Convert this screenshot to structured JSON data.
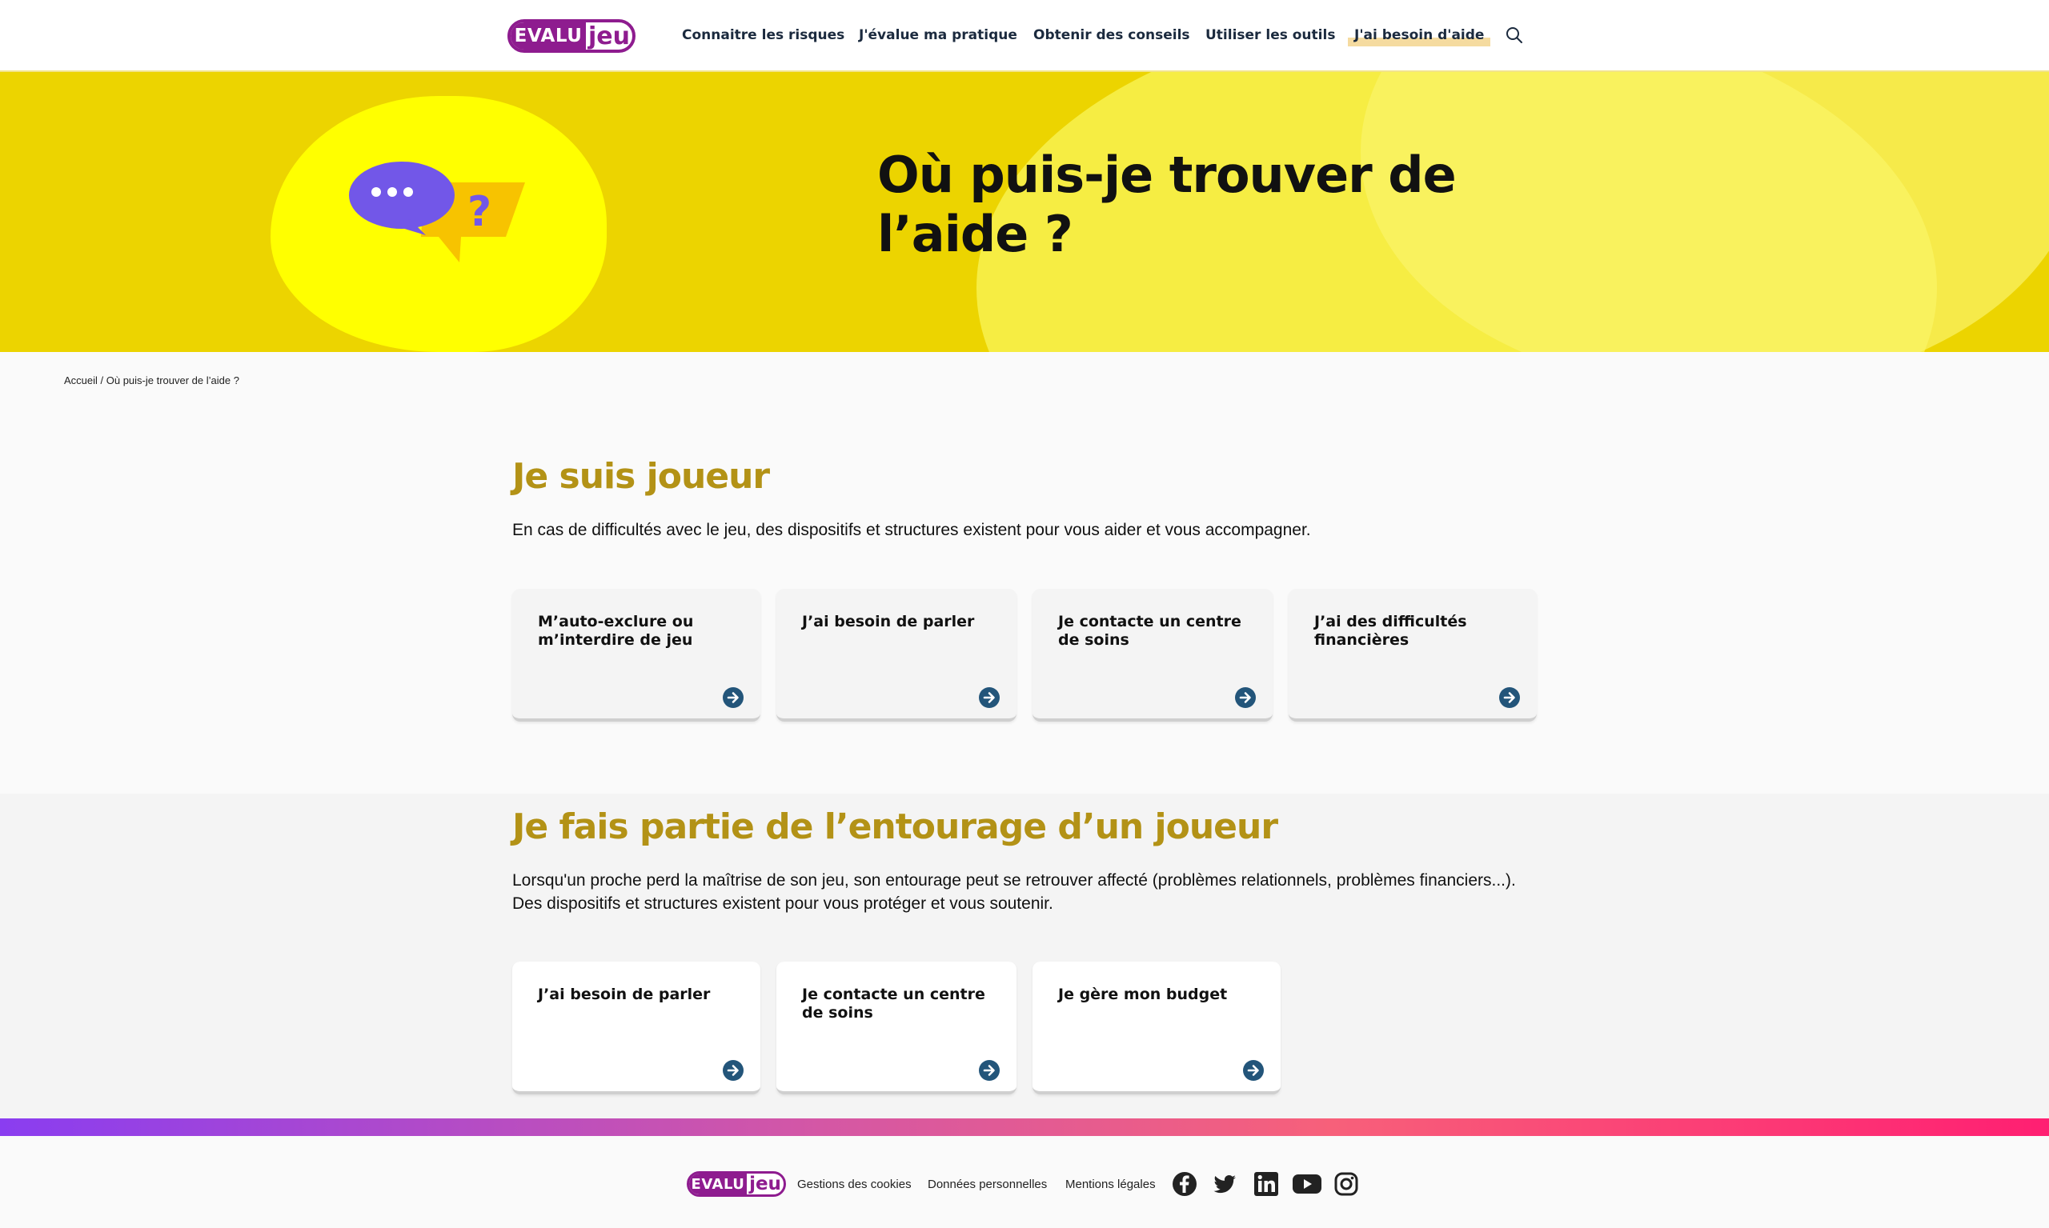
{
  "header": {
    "logo": {
      "part1": "EVALU",
      "part2": "jeu"
    },
    "nav": [
      {
        "label": "Connaitre les risques"
      },
      {
        "label": "J'évalue ma pratique"
      },
      {
        "label": "Obtenir des conseils"
      },
      {
        "label": "Utiliser les outils"
      },
      {
        "label": "J'ai besoin d'aide"
      }
    ],
    "search_icon": "search-icon"
  },
  "hero": {
    "title": "Où puis-je trouver de l’aide ?",
    "icon": "speech-bubbles-question-icon"
  },
  "breadcrumb": "Accueil / Où puis-je trouver de l’aide ?",
  "section1": {
    "title": "Je suis joueur",
    "desc": "En cas de difficultés avec le jeu, des dispositifs et structures existent pour vous aider et vous accompagner.",
    "cards": [
      {
        "label": "M’auto-exclure ou m’interdire de jeu"
      },
      {
        "label": "J’ai besoin de parler"
      },
      {
        "label": "Je contacte un centre de soins"
      },
      {
        "label": "J’ai des difficultés financières"
      }
    ]
  },
  "section2": {
    "title": "Je fais partie de l’entourage d’un joueur",
    "desc": "Lorsqu'un proche perd la maîtrise de son jeu, son entourage peut se retrouver affecté (problèmes relationnels, problèmes financiers...). Des dispositifs et structures existent pour vous protéger et vous soutenir.",
    "cards": [
      {
        "label": "J’ai besoin de parler"
      },
      {
        "label": "Je contacte un centre de soins"
      },
      {
        "label": "Je gère mon budget"
      }
    ]
  },
  "footer": {
    "logo": {
      "part1": "EVALU",
      "part2": "jeu"
    },
    "links": [
      {
        "label": "Gestions des cookies"
      },
      {
        "label": "Données personnelles"
      },
      {
        "label": "Mentions légales"
      }
    ],
    "social": [
      "facebook-icon",
      "twitter-icon",
      "linkedin-icon",
      "youtube-icon",
      "instagram-icon"
    ]
  },
  "colors": {
    "brand": "#8e1c8f",
    "hero_yellow": "#ecd400",
    "section_title": "#b39216",
    "arrow_blue": "#23557a"
  }
}
